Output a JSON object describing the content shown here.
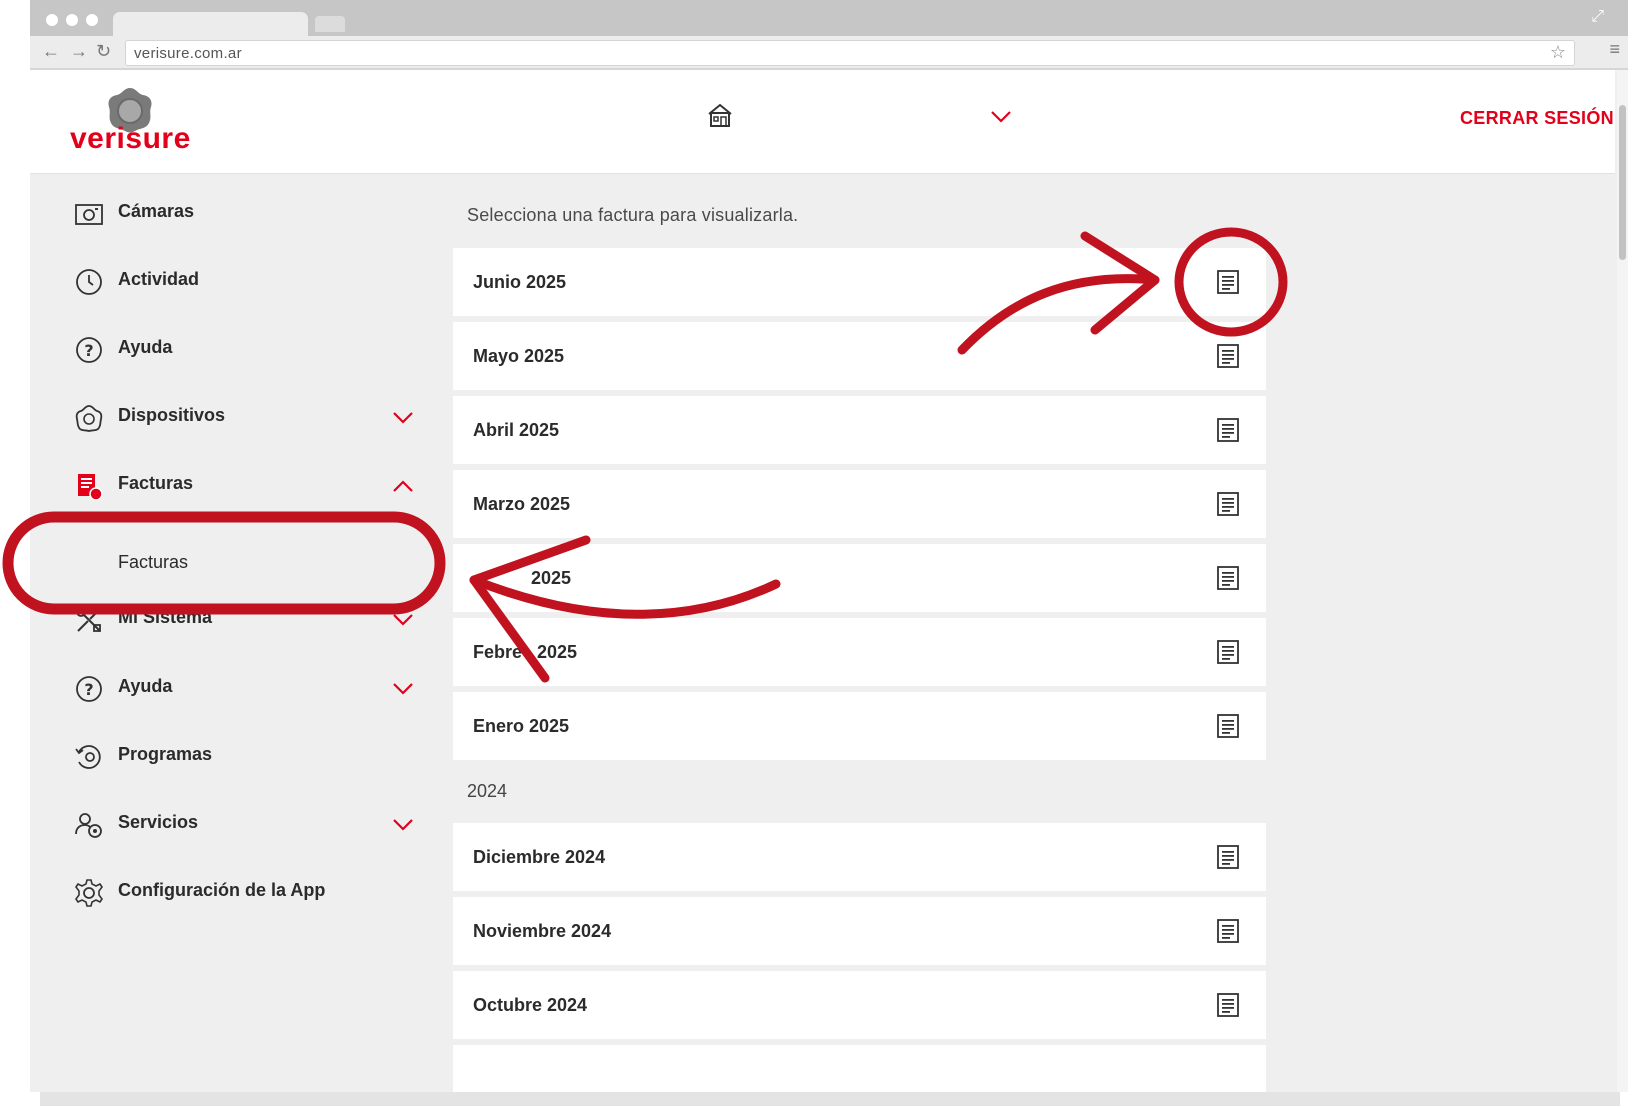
{
  "browser": {
    "url": "verisure.com.ar"
  },
  "header": {
    "logo_text": "verisure",
    "logout_label": "CERRAR SESIÓN"
  },
  "sidebar": {
    "items": [
      {
        "label": "Cámaras",
        "icon": "camera-icon"
      },
      {
        "label": "Actividad",
        "icon": "clock-icon"
      },
      {
        "label": "Ayuda",
        "icon": "help-icon"
      },
      {
        "label": "Dispositivos",
        "icon": "device-icon",
        "chevron": "down"
      },
      {
        "label": "Facturas",
        "icon": "invoice-icon",
        "chevron": "up"
      },
      {
        "label": "Mi Sistema",
        "icon": "tools-icon",
        "chevron": "down"
      },
      {
        "label": "Ayuda",
        "icon": "help-icon",
        "chevron": "down"
      },
      {
        "label": "Programas",
        "icon": "schedule-icon"
      },
      {
        "label": "Servicios",
        "icon": "services-icon",
        "chevron": "down"
      },
      {
        "label": "Configuración de la App",
        "icon": "gear-icon"
      }
    ],
    "sub_item": "Facturas"
  },
  "content": {
    "instruction": "Selecciona una factura para visualizarla.",
    "invoices_current": [
      "Junio 2025",
      "Mayo 2025",
      "Abril 2025",
      "Marzo 2025",
      "2025",
      "Febre   2025",
      "Enero 2025"
    ],
    "year_header": "2024",
    "invoices_previous": [
      "Diciembre 2024",
      "Noviembre 2024",
      "Octubre 2024"
    ]
  },
  "colors": {
    "brand_red": "#e2001a",
    "annotation_red": "#c1121f",
    "sidebar_bg": "#efefef"
  }
}
